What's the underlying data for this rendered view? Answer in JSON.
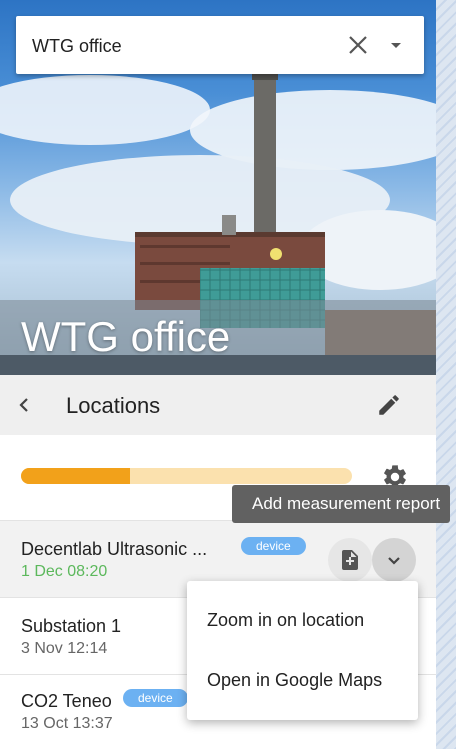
{
  "search": {
    "value": "WTG office",
    "clear_icon": "close-icon",
    "dropdown_icon": "caret-down-icon"
  },
  "hero": {
    "title": "WTG office"
  },
  "header": {
    "title": "Locations",
    "back_icon": "chevron-left-icon",
    "edit_icon": "pencil-icon"
  },
  "progress": {
    "fraction": 0.33,
    "fill_color": "#f2a11a",
    "track_color": "#fbe1ae"
  },
  "settings_icon": "gear-icon",
  "tooltip": {
    "text": "Add measurement report"
  },
  "locations": [
    {
      "name": "Decentlab Ultrasonic ...",
      "date": "1 Dec 08:20",
      "badge": "device"
    },
    {
      "name": "Substation 1",
      "date": "3 Nov 12:14"
    },
    {
      "name": "CO2 Teneo",
      "date": "13 Oct 13:37",
      "badge": "device"
    }
  ],
  "menu": {
    "items": [
      "Zoom in on location",
      "Open in Google Maps"
    ]
  },
  "colors": {
    "badge": "#6cb1f2",
    "date_recent": "#5cb85c"
  }
}
